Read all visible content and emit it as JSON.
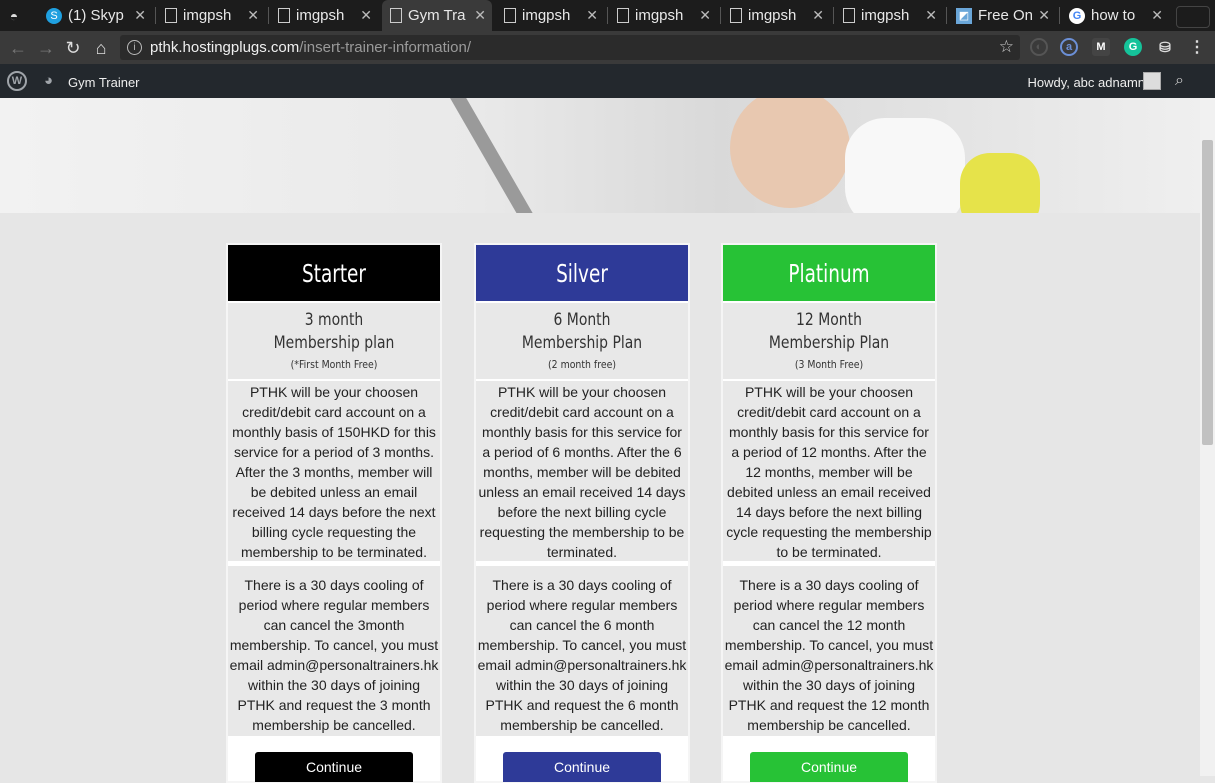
{
  "browser": {
    "tabs": [
      {
        "title": "",
        "icon": "incognito-icon"
      },
      {
        "title": "(1) Skyp",
        "icon": "skype-icon"
      },
      {
        "title": "imgpsh",
        "icon": "page-icon"
      },
      {
        "title": "imgpsh",
        "icon": "page-icon"
      },
      {
        "title": "Gym Tra",
        "icon": "page-icon",
        "active": true
      },
      {
        "title": "imgpsh",
        "icon": "page-icon"
      },
      {
        "title": "imgpsh",
        "icon": "page-icon"
      },
      {
        "title": "imgpsh",
        "icon": "page-icon"
      },
      {
        "title": "imgpsh",
        "icon": "page-icon"
      },
      {
        "title": "Free On",
        "icon": "app-icon"
      },
      {
        "title": "how to",
        "icon": "google-icon"
      }
    ],
    "url_host": "pthk.hostingplugs.com",
    "url_path": "/insert-trainer-information/"
  },
  "wp_admin_bar": {
    "site_name": "Gym Trainer",
    "howdy": "Howdy, abc adnamn"
  },
  "colors": {
    "starter": "#000000",
    "silver": "#2e3a98",
    "platinum": "#27c236"
  },
  "plans": [
    {
      "name": "Starter",
      "line1": "3 month",
      "line2": "Membership plan",
      "note": "(*First Month Free)",
      "desc1": "PTHK will be your choosen credit/debit card account on a monthly basis of 150HKD for this service for a period of 3 months. After the 3 months, member will be debited unless an email received 14 days before the next billing cycle requesting the membership to be terminated.",
      "desc2": "There is a 30 days cooling of period where regular members can cancel the 3month membership. To cancel, you must email admin@personaltrainers.hk within the 30 days of joining PTHK and request the 3 month membership be cancelled.",
      "button": "Continue"
    },
    {
      "name": "Silver",
      "line1": "6 Month",
      "line2": "Membership Plan",
      "note": "(2 month free)",
      "desc1": "PTHK will be your choosen credit/debit card account on a monthly basis for this service for a period of 6 months. After the 6 months, member will be debited unless an email received 14 days before the next billing cycle requesting the membership to be terminated.",
      "desc2": "There is a 30 days cooling of period where regular members can cancel the 6 month membership. To cancel, you must email admin@personaltrainers.hk within the 30 days of joining PTHK and request the 6 month membership be cancelled.",
      "button": "Continue"
    },
    {
      "name": "Platinum",
      "line1": "12 Month",
      "line2": "Membership Plan",
      "note": "(3 Month Free)",
      "desc1": "PTHK will be your choosen credit/debit card account on a monthly basis for this service for a period of 12 months. After the 12 months, member will be debited unless an email received 14 days before the next billing cycle requesting the membership to be terminated.",
      "desc2": "There is a 30 days cooling of period where regular members can cancel the 12 month membership. To cancel, you must email admin@personaltrainers.hk within the 30 days of joining PTHK and request the 12 month membership be cancelled.",
      "button": "Continue"
    }
  ]
}
